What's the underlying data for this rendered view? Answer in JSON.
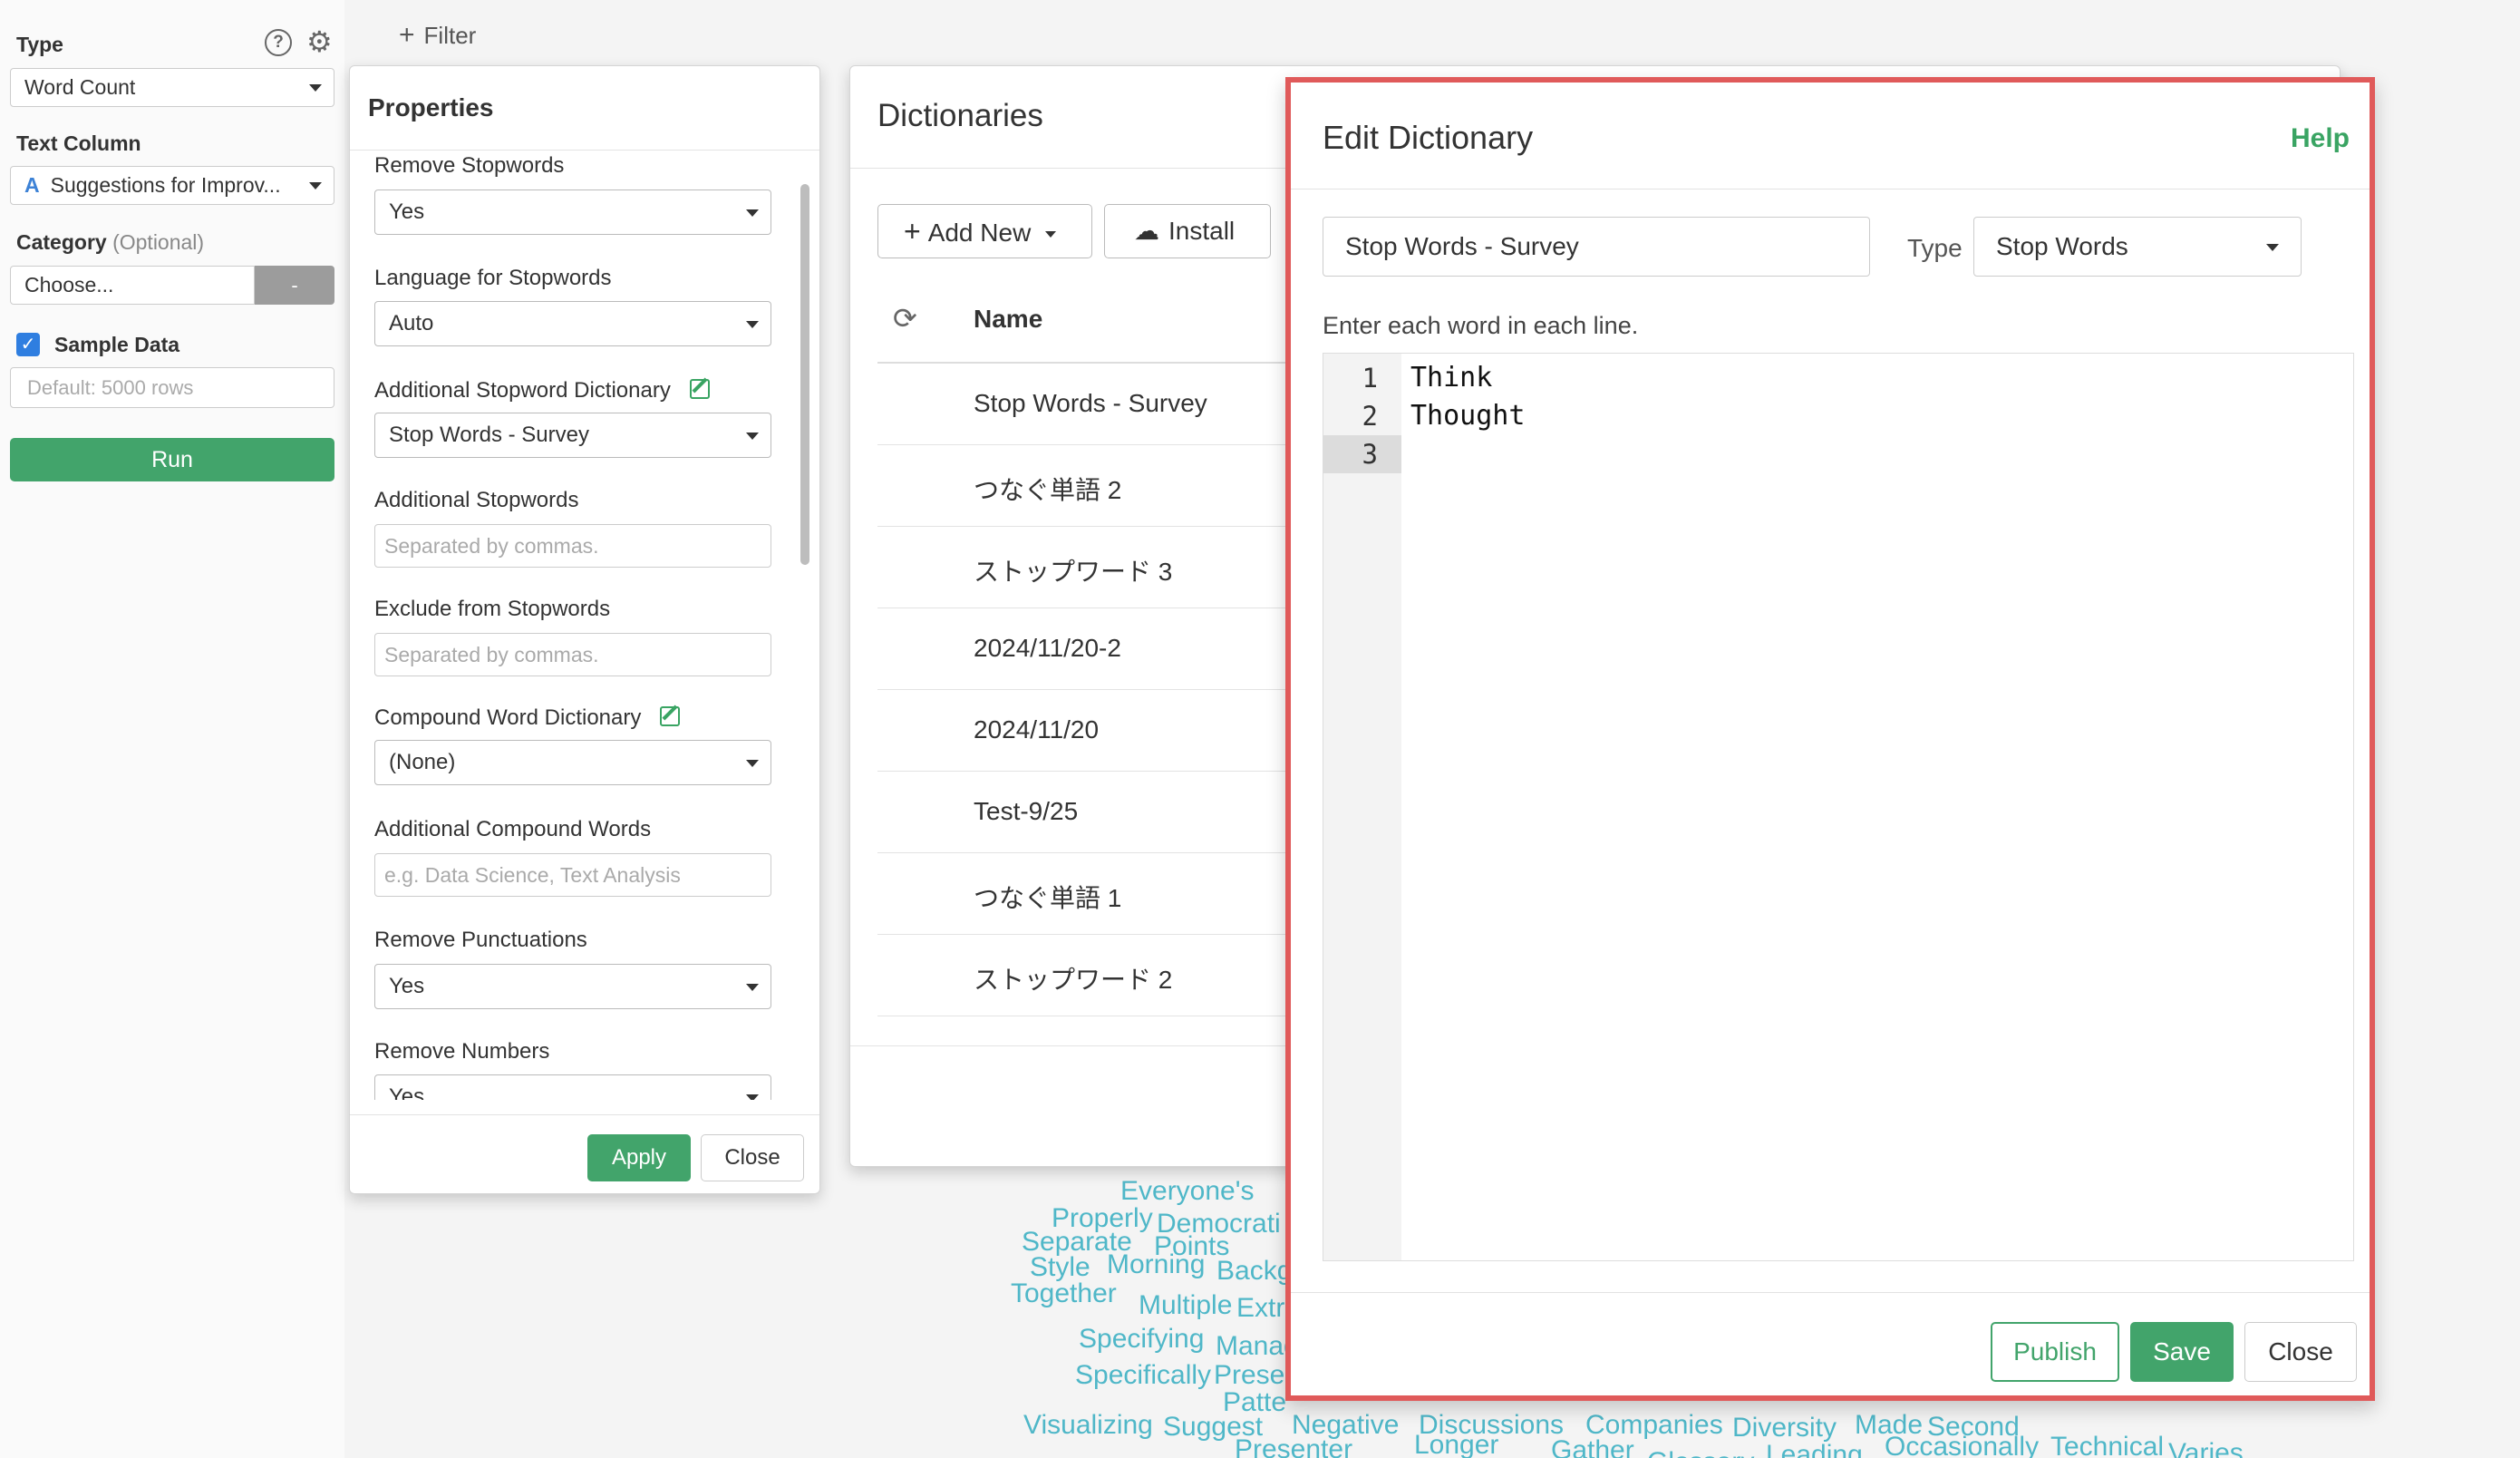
{
  "sidebar": {
    "type_label": "Type",
    "type_value": "Word Count",
    "text_column_label": "Text Column",
    "text_column_icon": "A",
    "text_column_value": "Suggestions for Improv...",
    "category_label": "Category",
    "category_optional": "(Optional)",
    "category_value": "Choose...",
    "category_button": "-",
    "sample_data_label": "Sample Data",
    "sample_data_checked": true,
    "sample_rows_placeholder": "Default: 5000 rows",
    "run_label": "Run"
  },
  "toolbar": {
    "filter_label": "Filter"
  },
  "properties": {
    "title": "Properties",
    "remove_stopwords_label": "Remove Stopwords",
    "remove_stopwords_value": "Yes",
    "language_label": "Language for Stopwords",
    "language_value": "Auto",
    "additional_dict_label": "Additional Stopword Dictionary",
    "additional_dict_value": "Stop Words - Survey",
    "additional_stopwords_label": "Additional Stopwords",
    "additional_stopwords_placeholder": "Separated by commas.",
    "exclude_label": "Exclude from Stopwords",
    "exclude_placeholder": "Separated by commas.",
    "compound_dict_label": "Compound Word Dictionary",
    "compound_dict_value": "(None)",
    "additional_compound_label": "Additional Compound Words",
    "additional_compound_placeholder": "e.g. Data Science, Text Analysis",
    "remove_punct_label": "Remove Punctuations",
    "remove_punct_value": "Yes",
    "remove_numbers_label": "Remove Numbers",
    "remove_numbers_value": "Yes",
    "apply_label": "Apply",
    "close_label": "Close"
  },
  "dictionaries": {
    "title": "Dictionaries",
    "add_new_label": "Add New",
    "install_label": "Install",
    "name_header": "Name",
    "rows": [
      "Stop Words - Survey",
      "つなぐ単語 2",
      "ストップワード 3",
      "2024/11/20-2",
      "2024/11/20",
      "Test-9/25",
      "つなぐ単語 1",
      "ストップワード 2"
    ]
  },
  "edit_dictionary": {
    "title": "Edit Dictionary",
    "help_label": "Help",
    "name_value": "Stop Words - Survey",
    "type_label": "Type",
    "type_value": "Stop Words",
    "instruction": "Enter each word in each line.",
    "lines": [
      {
        "num": "1",
        "text": "Think"
      },
      {
        "num": "2",
        "text": "Thought"
      },
      {
        "num": "3",
        "text": ""
      }
    ],
    "publish_label": "Publish",
    "save_label": "Save",
    "close_label": "Close"
  },
  "background_words": [
    "Everyone's",
    "Properly",
    "Democrati",
    "Separate",
    "Points",
    "Style",
    "Morning",
    "Backg",
    "Together",
    "Multiple",
    "Extra",
    "Specifying",
    "Manag",
    "Specifically",
    "Prese",
    "Patte",
    "Visualizing",
    "Suggest",
    "Negative",
    "Discussions",
    "Companies",
    "Diversity",
    "Made",
    "Second",
    "Presenter",
    "Longer",
    "Gather",
    "Glossary",
    "Leading",
    "Occasionally",
    "Technical",
    "Varies"
  ],
  "colors": {
    "accent_green": "#42a46b",
    "highlight_red": "#e05a5a",
    "word_cloud": "#4fb7c8"
  }
}
